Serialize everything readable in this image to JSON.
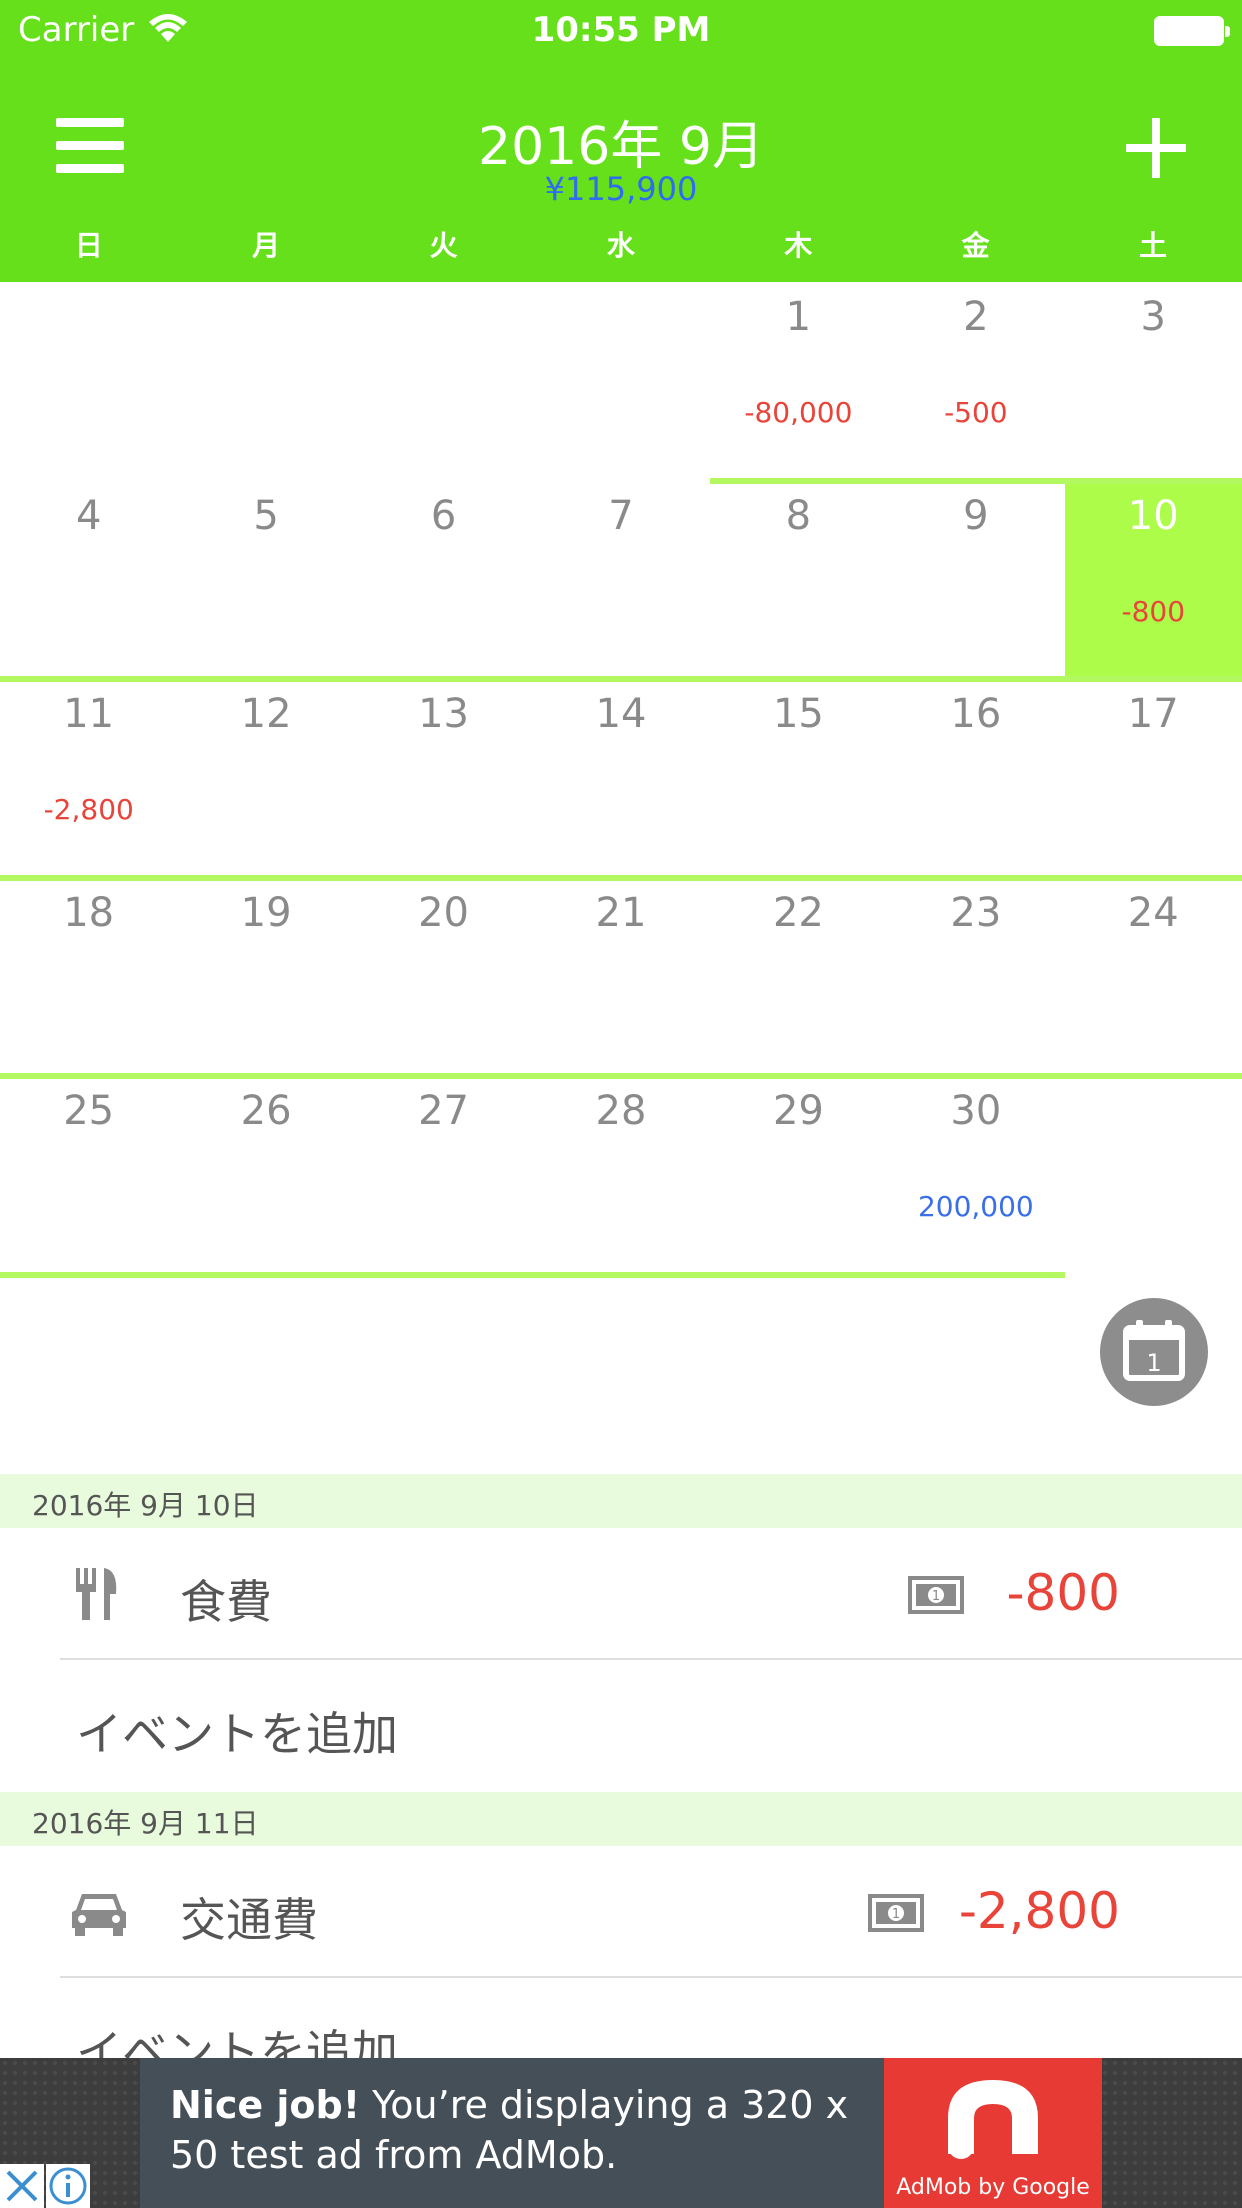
{
  "status_bar": {
    "carrier": "Carrier",
    "time": "10:55 PM"
  },
  "header": {
    "month_title": "2016年 9月",
    "month_total": "¥115,900"
  },
  "weekdays": [
    "日",
    "月",
    "火",
    "水",
    "木",
    "金",
    "土"
  ],
  "calendar": {
    "days": [
      {
        "n": "1",
        "amount": "-80,000",
        "kind": "neg"
      },
      {
        "n": "2",
        "amount": "-500",
        "kind": "neg"
      },
      {
        "n": "3"
      },
      {
        "n": "4"
      },
      {
        "n": "5"
      },
      {
        "n": "6"
      },
      {
        "n": "7"
      },
      {
        "n": "8"
      },
      {
        "n": "9"
      },
      {
        "n": "10",
        "amount": "-800",
        "kind": "neg",
        "selected": true
      },
      {
        "n": "11",
        "amount": "-2,800",
        "kind": "neg"
      },
      {
        "n": "12"
      },
      {
        "n": "13"
      },
      {
        "n": "14"
      },
      {
        "n": "15"
      },
      {
        "n": "16"
      },
      {
        "n": "17"
      },
      {
        "n": "18"
      },
      {
        "n": "19"
      },
      {
        "n": "20"
      },
      {
        "n": "21"
      },
      {
        "n": "22"
      },
      {
        "n": "23"
      },
      {
        "n": "24"
      },
      {
        "n": "25"
      },
      {
        "n": "26"
      },
      {
        "n": "27"
      },
      {
        "n": "28"
      },
      {
        "n": "29"
      },
      {
        "n": "30",
        "amount": "200,000",
        "kind": "pos"
      }
    ],
    "today_button_label": "1"
  },
  "events": {
    "section1": {
      "date": "2016年 9月 10日",
      "item": {
        "category": "食費",
        "icon": "fork-knife-icon",
        "amount": "-800"
      },
      "add_label": "イベントを追加"
    },
    "section2": {
      "date": "2016年 9月 11日",
      "item": {
        "category": "交通費",
        "icon": "car-icon",
        "amount": "-2,800"
      },
      "add_label": "イベントを追加"
    }
  },
  "ad": {
    "headline": "Nice job!",
    "body": " You’re displaying a 320 x 50 test ad from AdMob.",
    "brand": "AdMob by Google"
  },
  "colors": {
    "header": "#66e01a",
    "selected_day": "#aefc4a",
    "negative": "#e8443a",
    "positive": "#3b6fea",
    "section": "#e8fbdd"
  }
}
